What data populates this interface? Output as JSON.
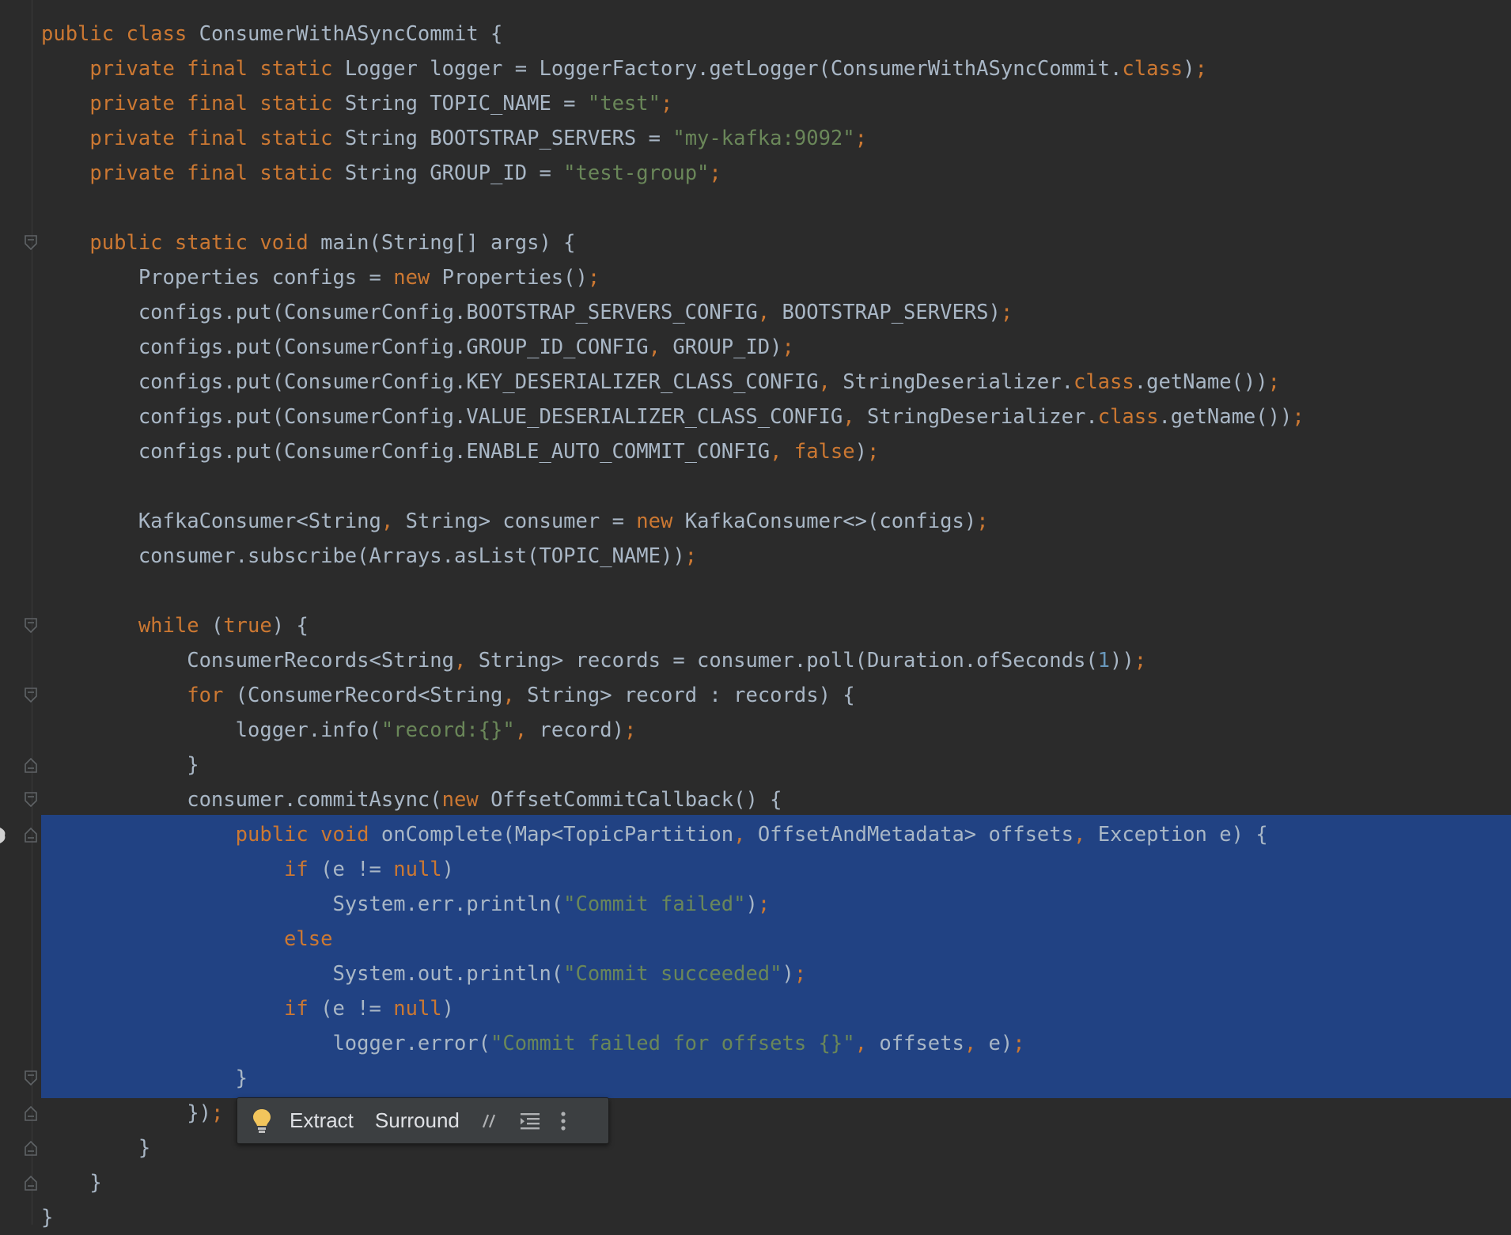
{
  "colors": {
    "background": "#2b2b2b",
    "selection": "#214283",
    "keyword": "#cc7832",
    "string": "#6a8759",
    "number": "#6897bb",
    "text": "#a9b7c6"
  },
  "code_lines": [
    [
      [
        "kw",
        "public class "
      ],
      [
        "t",
        "ConsumerWithASyncCommit {"
      ]
    ],
    [
      [
        "t",
        "    "
      ],
      [
        "kw",
        "private final static "
      ],
      [
        "t",
        "Logger logger = LoggerFactory.getLogger(ConsumerWithASyncCommit."
      ],
      [
        "kw",
        "class"
      ],
      [
        "t",
        ")"
      ],
      [
        "kw",
        ";"
      ]
    ],
    [
      [
        "t",
        "    "
      ],
      [
        "kw",
        "private final static "
      ],
      [
        "t",
        "String TOPIC_NAME = "
      ],
      [
        "str",
        "\"test\""
      ],
      [
        "kw",
        ";"
      ]
    ],
    [
      [
        "t",
        "    "
      ],
      [
        "kw",
        "private final static "
      ],
      [
        "t",
        "String BOOTSTRAP_SERVERS = "
      ],
      [
        "str",
        "\"my-kafka:9092\""
      ],
      [
        "kw",
        ";"
      ]
    ],
    [
      [
        "t",
        "    "
      ],
      [
        "kw",
        "private final static "
      ],
      [
        "t",
        "String GROUP_ID = "
      ],
      [
        "str",
        "\"test-group\""
      ],
      [
        "kw",
        ";"
      ]
    ],
    [
      [
        "t",
        ""
      ]
    ],
    [
      [
        "t",
        "    "
      ],
      [
        "kw",
        "public static void "
      ],
      [
        "t",
        "main(String[] args) {"
      ]
    ],
    [
      [
        "t",
        "        Properties configs = "
      ],
      [
        "kw",
        "new "
      ],
      [
        "t",
        "Properties()"
      ],
      [
        "kw",
        ";"
      ]
    ],
    [
      [
        "t",
        "        configs.put(ConsumerConfig.BOOTSTRAP_SERVERS_CONFIG"
      ],
      [
        "kw",
        ", "
      ],
      [
        "t",
        "BOOTSTRAP_SERVERS)"
      ],
      [
        "kw",
        ";"
      ]
    ],
    [
      [
        "t",
        "        configs.put(ConsumerConfig.GROUP_ID_CONFIG"
      ],
      [
        "kw",
        ", "
      ],
      [
        "t",
        "GROUP_ID)"
      ],
      [
        "kw",
        ";"
      ]
    ],
    [
      [
        "t",
        "        configs.put(ConsumerConfig.KEY_DESERIALIZER_CLASS_CONFIG"
      ],
      [
        "kw",
        ", "
      ],
      [
        "t",
        "StringDeserializer."
      ],
      [
        "kw",
        "class"
      ],
      [
        "t",
        ".getName())"
      ],
      [
        "kw",
        ";"
      ]
    ],
    [
      [
        "t",
        "        configs.put(ConsumerConfig.VALUE_DESERIALIZER_CLASS_CONFIG"
      ],
      [
        "kw",
        ", "
      ],
      [
        "t",
        "StringDeserializer."
      ],
      [
        "kw",
        "class"
      ],
      [
        "t",
        ".getName())"
      ],
      [
        "kw",
        ";"
      ]
    ],
    [
      [
        "t",
        "        configs.put(ConsumerConfig.ENABLE_AUTO_COMMIT_CONFIG"
      ],
      [
        "kw",
        ", false"
      ],
      [
        "t",
        ")"
      ],
      [
        "kw",
        ";"
      ]
    ],
    [
      [
        "t",
        ""
      ]
    ],
    [
      [
        "t",
        "        KafkaConsumer<String"
      ],
      [
        "kw",
        ", "
      ],
      [
        "t",
        "String> consumer = "
      ],
      [
        "kw",
        "new "
      ],
      [
        "t",
        "KafkaConsumer<>(configs)"
      ],
      [
        "kw",
        ";"
      ]
    ],
    [
      [
        "t",
        "        consumer.subscribe(Arrays.asList(TOPIC_NAME))"
      ],
      [
        "kw",
        ";"
      ]
    ],
    [
      [
        "t",
        ""
      ]
    ],
    [
      [
        "t",
        "        "
      ],
      [
        "kw",
        "while "
      ],
      [
        "t",
        "("
      ],
      [
        "kw",
        "true"
      ],
      [
        "t",
        ") {"
      ]
    ],
    [
      [
        "t",
        "            ConsumerRecords<String"
      ],
      [
        "kw",
        ", "
      ],
      [
        "t",
        "String> records = consumer.poll(Duration.ofSeconds("
      ],
      [
        "num",
        "1"
      ],
      [
        "t",
        "))"
      ],
      [
        "kw",
        ";"
      ]
    ],
    [
      [
        "t",
        "            "
      ],
      [
        "kw",
        "for "
      ],
      [
        "t",
        "(ConsumerRecord<String"
      ],
      [
        "kw",
        ", "
      ],
      [
        "t",
        "String> record : records) {"
      ]
    ],
    [
      [
        "t",
        "                logger.info("
      ],
      [
        "str",
        "\"record:{}\""
      ],
      [
        "kw",
        ", "
      ],
      [
        "t",
        "record)"
      ],
      [
        "kw",
        ";"
      ]
    ],
    [
      [
        "t",
        "            }"
      ]
    ],
    [
      [
        "t",
        "            consumer.commitAsync("
      ],
      [
        "kw",
        "new "
      ],
      [
        "t",
        "OffsetCommitCallback() {"
      ]
    ],
    [
      [
        "t",
        "                "
      ],
      [
        "kw",
        "public void "
      ],
      [
        "t",
        "onComplete(Map<TopicPartition"
      ],
      [
        "kw",
        ", "
      ],
      [
        "t",
        "OffsetAndMetadata> offsets"
      ],
      [
        "kw",
        ", "
      ],
      [
        "t",
        "Exception e) {"
      ]
    ],
    [
      [
        "t",
        "                    "
      ],
      [
        "kw",
        "if "
      ],
      [
        "t",
        "(e != "
      ],
      [
        "kw",
        "null"
      ],
      [
        "t",
        ")"
      ]
    ],
    [
      [
        "t",
        "                        System.err.println("
      ],
      [
        "str",
        "\"Commit failed\""
      ],
      [
        "t",
        ")"
      ],
      [
        "kw",
        ";"
      ]
    ],
    [
      [
        "t",
        "                    "
      ],
      [
        "kw",
        "else"
      ]
    ],
    [
      [
        "t",
        "                        System.out.println("
      ],
      [
        "str",
        "\"Commit succeeded\""
      ],
      [
        "t",
        ")"
      ],
      [
        "kw",
        ";"
      ]
    ],
    [
      [
        "t",
        "                    "
      ],
      [
        "kw",
        "if "
      ],
      [
        "t",
        "(e != "
      ],
      [
        "kw",
        "null"
      ],
      [
        "t",
        ")"
      ]
    ],
    [
      [
        "t",
        "                        logger.error("
      ],
      [
        "str",
        "\"Commit failed for offsets {}\""
      ],
      [
        "kw",
        ", "
      ],
      [
        "t",
        "offsets"
      ],
      [
        "kw",
        ", "
      ],
      [
        "t",
        "e)"
      ],
      [
        "kw",
        ";"
      ]
    ],
    [
      [
        "t",
        "                }"
      ]
    ],
    [
      [
        "t",
        "            })"
      ],
      [
        "kw",
        ";"
      ]
    ],
    [
      [
        "t",
        "        }"
      ]
    ],
    [
      [
        "t",
        "    }"
      ]
    ],
    [
      [
        "t",
        "}"
      ]
    ]
  ],
  "selection": {
    "first_line": 23,
    "last_line": 30
  },
  "fold_markers": [
    {
      "line": 6,
      "kind": "open"
    },
    {
      "line": 17,
      "kind": "open"
    },
    {
      "line": 19,
      "kind": "open"
    },
    {
      "line": 21,
      "kind": "close"
    },
    {
      "line": 22,
      "kind": "open"
    },
    {
      "line": 23,
      "kind": "close"
    },
    {
      "line": 30,
      "kind": "open"
    },
    {
      "line": 31,
      "kind": "close"
    },
    {
      "line": 32,
      "kind": "close"
    },
    {
      "line": 33,
      "kind": "close"
    }
  ],
  "floating_toolbar": {
    "icon": "lightbulb-icon",
    "extract_label": "Extract",
    "surround_label": "Surround",
    "comment_icon": "comment-icon",
    "indent_icon": "reformat-icon",
    "more_icon": "more-vertical-icon"
  }
}
